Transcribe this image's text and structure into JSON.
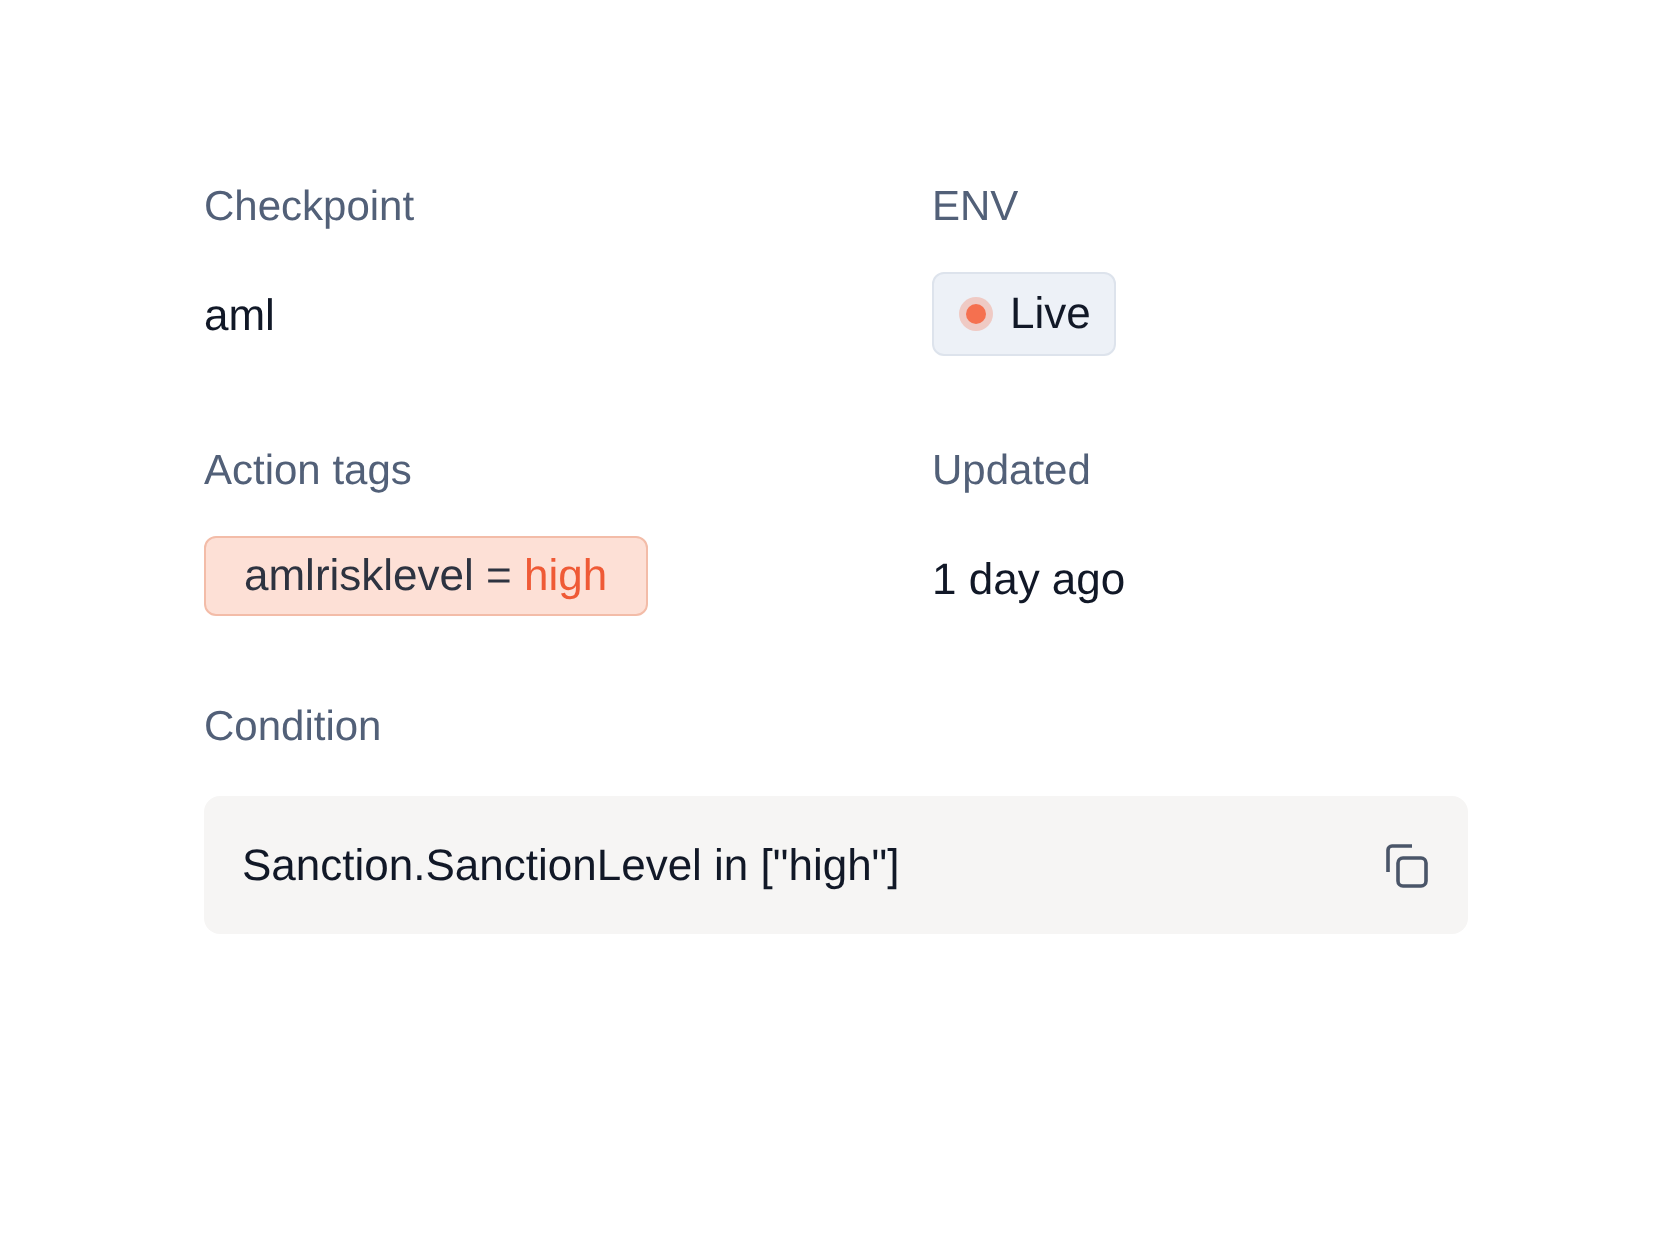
{
  "checkpoint": {
    "label": "Checkpoint",
    "value": "aml"
  },
  "env": {
    "label": "ENV",
    "badge": {
      "text": "Live",
      "color": "#f5704f"
    }
  },
  "action_tags": {
    "label": "Action tags",
    "tags": [
      {
        "key": "amlrisklevel",
        "operator": "=",
        "value": "high"
      }
    ]
  },
  "updated": {
    "label": "Updated",
    "value": "1 day ago"
  },
  "condition": {
    "label": "Condition",
    "code": "Sanction.SanctionLevel in [\"high\"]"
  }
}
